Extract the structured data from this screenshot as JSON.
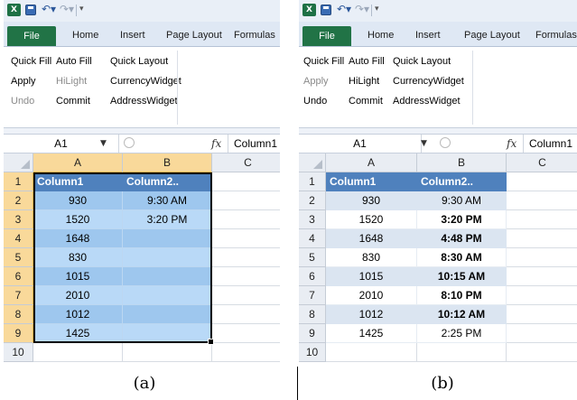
{
  "panels": [
    {
      "id": "a",
      "caption": "(a)",
      "qat": {
        "excel_icon_letter": "X"
      },
      "tabs": [
        "File",
        "Home",
        "Insert",
        "Page Layout",
        "Formulas"
      ],
      "ribbon_rows": [
        [
          {
            "label": "Quick Fill",
            "disabled": false
          },
          {
            "label": "Auto Fill",
            "disabled": false
          },
          {
            "label": "Quick Layout",
            "disabled": false
          }
        ],
        [
          {
            "label": "Apply",
            "disabled": false
          },
          {
            "label": "HiLight",
            "disabled": true
          },
          {
            "label": "CurrencyWidget",
            "disabled": false
          }
        ],
        [
          {
            "label": "Undo",
            "disabled": true
          },
          {
            "label": "Commit",
            "disabled": false
          },
          {
            "label": "AddressWidget",
            "disabled": false
          }
        ]
      ],
      "formula": {
        "cell_ref": "A1",
        "fx_symbol": "fx",
        "value": "Column1"
      },
      "columns": [
        "A",
        "B",
        "C"
      ],
      "selected_columns": [
        "A",
        "B"
      ],
      "row_numbers": [
        "1",
        "2",
        "3",
        "4",
        "5",
        "6",
        "7",
        "8",
        "9",
        "10"
      ],
      "selected_rows": [
        "1",
        "2",
        "3",
        "4",
        "5",
        "6",
        "7",
        "8",
        "9"
      ],
      "table_header": [
        "Column1",
        "Column2.."
      ],
      "rows": [
        [
          "930",
          "9:30 AM"
        ],
        [
          "1520",
          "3:20 PM"
        ],
        [
          "1648",
          ""
        ],
        [
          "830",
          ""
        ],
        [
          "1015",
          ""
        ],
        [
          "2010",
          ""
        ],
        [
          "1012",
          ""
        ],
        [
          "1425",
          ""
        ]
      ],
      "bold_column2_rows": []
    },
    {
      "id": "b",
      "caption": "(b)",
      "qat": {
        "excel_icon_letter": "X"
      },
      "tabs": [
        "File",
        "Home",
        "Insert",
        "Page Layout",
        "Formulas"
      ],
      "ribbon_rows": [
        [
          {
            "label": "Quick Fill",
            "disabled": false
          },
          {
            "label": "Auto Fill",
            "disabled": false
          },
          {
            "label": "Quick Layout",
            "disabled": false
          }
        ],
        [
          {
            "label": "Apply",
            "disabled": true
          },
          {
            "label": "HiLight",
            "disabled": false
          },
          {
            "label": "CurrencyWidget",
            "disabled": false
          }
        ],
        [
          {
            "label": "Undo",
            "disabled": false
          },
          {
            "label": "Commit",
            "disabled": false
          },
          {
            "label": "AddressWidget",
            "disabled": false
          }
        ]
      ],
      "formula": {
        "cell_ref": "A1",
        "fx_symbol": "fx",
        "value": "Column1"
      },
      "columns": [
        "A",
        "B",
        "C"
      ],
      "selected_columns": [],
      "row_numbers": [
        "1",
        "2",
        "3",
        "4",
        "5",
        "6",
        "7",
        "8",
        "9",
        "10"
      ],
      "selected_rows": [],
      "table_header": [
        "Column1",
        "Column2.."
      ],
      "rows": [
        [
          "930",
          "9:30 AM"
        ],
        [
          "1520",
          "3:20 PM"
        ],
        [
          "1648",
          "4:48 PM"
        ],
        [
          "830",
          "8:30 AM"
        ],
        [
          "1015",
          "10:15 AM"
        ],
        [
          "2010",
          "8:10 PM"
        ],
        [
          "1012",
          "10:12 AM"
        ],
        [
          "1425",
          "2:25 PM"
        ]
      ],
      "bold_column2_rows": [
        3,
        4,
        5,
        6,
        7,
        8
      ]
    }
  ]
}
